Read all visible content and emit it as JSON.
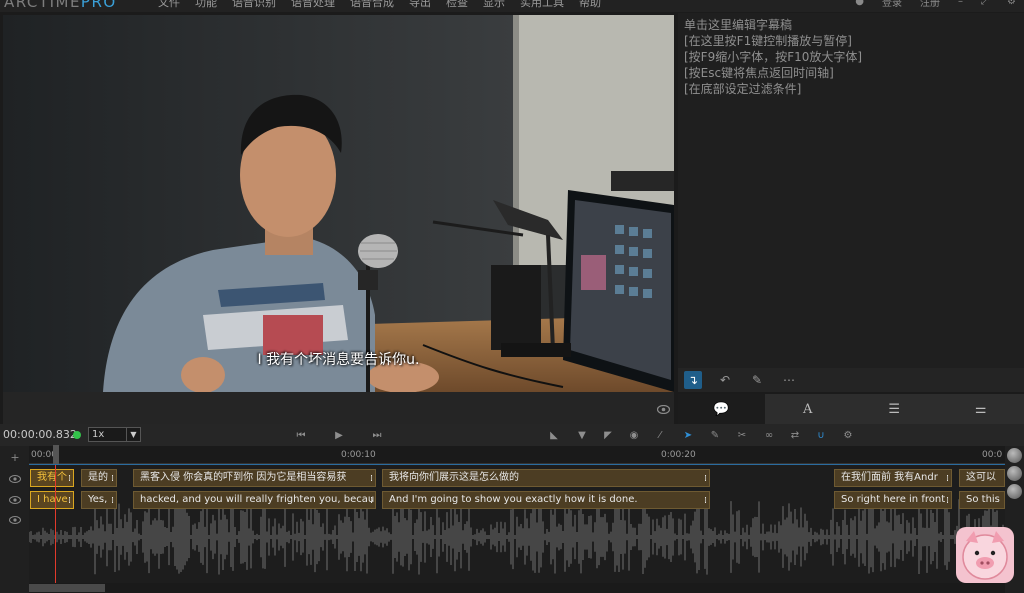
{
  "app": {
    "logo_main": "ARCTIME",
    "logo_pro": "PRO"
  },
  "menu": [
    "文件",
    "功能",
    "语音识别",
    "语音处理",
    "语音合成",
    "导出",
    "检查",
    "显示",
    "实用工具",
    "帮助"
  ],
  "menu_right": {
    "login": "登录",
    "register": "注册"
  },
  "video": {
    "subtitle": "I 我有个坏消息要告诉你u."
  },
  "editor": {
    "lines": [
      "单击这里编辑字幕稿",
      "[在这里按F1键控制播放与暂停]",
      "[按F9缩小字体，按F10放大字体]",
      "[按Esc键将焦点返回时间轴]",
      "[在底部设定过滤条件]"
    ]
  },
  "controls": {
    "time": "00:00:00.832",
    "speed": "1x"
  },
  "timeline": {
    "ruler_labels": [
      "00:00",
      "0:00:10",
      "0:00:20",
      "00:0"
    ],
    "cn_subs": [
      "我有个",
      "是的",
      "黑客入侵 你会真的吓到你 因为它是相当容易获",
      "我将向你们展示这是怎么做的",
      "在我们面前 我有Andr",
      "这可以"
    ],
    "en_subs": [
      "I have",
      "Yes,",
      "hacked, and you will really frighten you, becau",
      "And I'm going to show you exactly how it is done.",
      "So right here in front",
      "So this"
    ]
  },
  "colors": {
    "accent": "#2f8fd6",
    "playhead": "#e23a2c",
    "selected": "#f6c23b"
  }
}
